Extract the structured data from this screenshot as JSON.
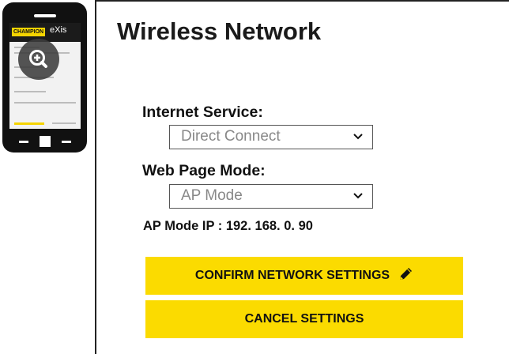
{
  "phone": {
    "brand_name": "CHAMPION",
    "brand_product": "eXis",
    "zoom_icon": "zoom-in-icon"
  },
  "main": {
    "title": "Wireless Network",
    "internet_service": {
      "label": "Internet Service:",
      "value": "Direct Connect"
    },
    "web_page_mode": {
      "label": "Web Page Mode:",
      "value": "AP Mode"
    },
    "ap_ip_line": "AP Mode IP : 192. 168. 0. 90",
    "confirm_button": "CONFIRM NETWORK SETTINGS",
    "cancel_button": "CANCEL SETTINGS"
  },
  "colors": {
    "accent_yellow": "#fbdb00",
    "phone_body": "#111111"
  }
}
